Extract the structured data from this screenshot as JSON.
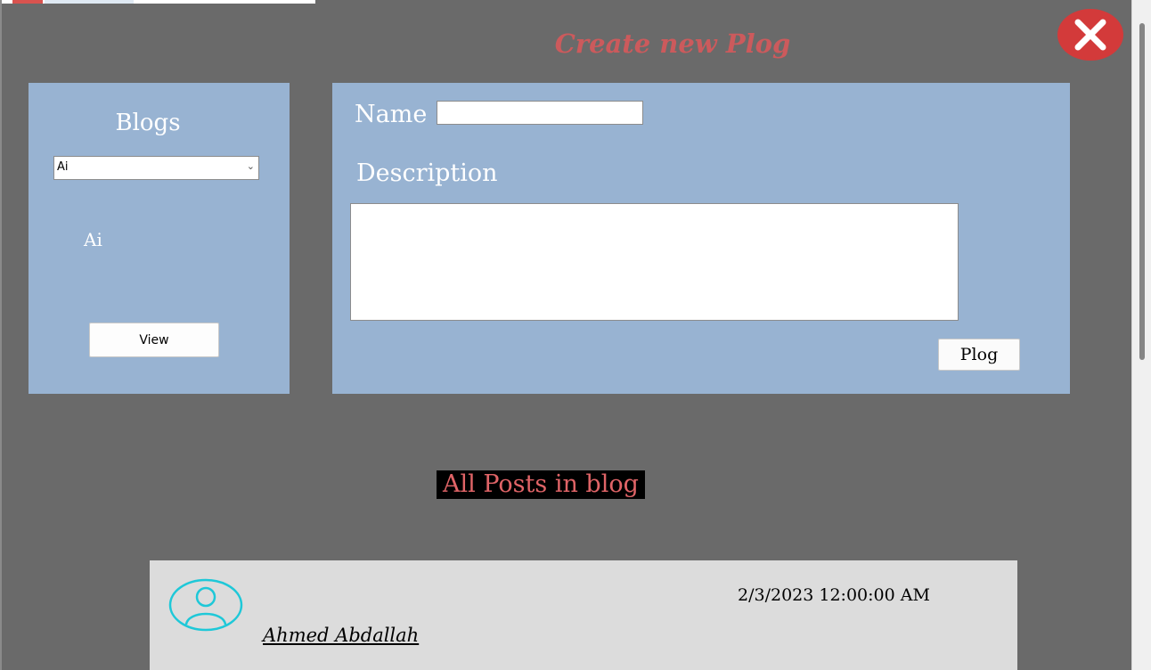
{
  "page_title": "Create new Plog",
  "close_icon": "close-icon",
  "blogs": {
    "title": "Blogs",
    "select_value": "Ai",
    "selected_label": "Ai",
    "view_label": "View"
  },
  "form": {
    "name_label": "Name",
    "name_value": "",
    "description_label": "Description",
    "description_value": "",
    "submit_label": "Plog"
  },
  "posts": {
    "heading": "All Posts in blog",
    "items": [
      {
        "avatar_icon": "user-avatar-icon",
        "date": "2/3/2023 12:00:00 AM",
        "author": "Ahmed Abdallah"
      }
    ]
  },
  "colors": {
    "background": "#6a6a6a",
    "panel": "#98b3d2",
    "accent_red": "#cc5a5c",
    "close_button": "#d33a3a",
    "avatar_cyan": "#1ec8d8"
  }
}
